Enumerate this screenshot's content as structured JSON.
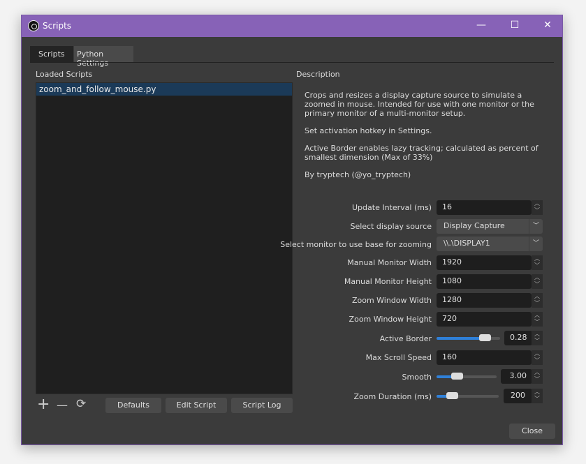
{
  "window": {
    "title": "Scripts",
    "minimize": "—",
    "maximize": "☐",
    "close": "✕"
  },
  "tabs": [
    {
      "label": "Scripts",
      "active": true
    },
    {
      "label": "Python Settings",
      "active": false
    }
  ],
  "loaded_scripts": {
    "label": "Loaded Scripts",
    "items": [
      "zoom_and_follow_mouse.py"
    ]
  },
  "list_buttons": {
    "add": "+",
    "remove": "—",
    "reload": "⟳",
    "defaults": "Defaults",
    "edit": "Edit Script",
    "log": "Script Log"
  },
  "description": {
    "label": "Description",
    "paragraphs": [
      "Crops and resizes a display capture source to simulate a zoomed in mouse. Intended for use with one monitor or the primary monitor of a multi-monitor setup.",
      "Set activation hotkey in Settings.",
      "Active Border enables lazy tracking; calculated as percent of smallest dimension (Max of 33%)",
      "By tryptech (@yo_tryptech)"
    ]
  },
  "settings": {
    "update_interval": {
      "label": "Update Interval (ms)",
      "value": "16"
    },
    "display_source": {
      "label": "Select display source",
      "value": "Display Capture"
    },
    "monitor": {
      "label": "Select monitor to use base for zooming",
      "value": "\\\\.\\DISPLAY1"
    },
    "monitor_width": {
      "label": "Manual Monitor Width",
      "value": "1920"
    },
    "monitor_height": {
      "label": "Manual Monitor Height",
      "value": "1080"
    },
    "zoom_width": {
      "label": "Zoom Window Width",
      "value": "1280"
    },
    "zoom_height": {
      "label": "Zoom Window Height",
      "value": "720"
    },
    "active_border": {
      "label": "Active Border",
      "value": "0.28",
      "slider_fraction": 0.82
    },
    "max_scroll": {
      "label": "Max Scroll Speed",
      "value": "160"
    },
    "smooth": {
      "label": "Smooth",
      "value": "3.00",
      "slider_fraction": 0.3
    },
    "zoom_duration": {
      "label": "Zoom Duration (ms)",
      "value": "200",
      "slider_fraction": 0.2
    }
  },
  "close_button": "Close",
  "colors": {
    "titlebar": "#8762b7",
    "accent": "#2f80d8"
  }
}
